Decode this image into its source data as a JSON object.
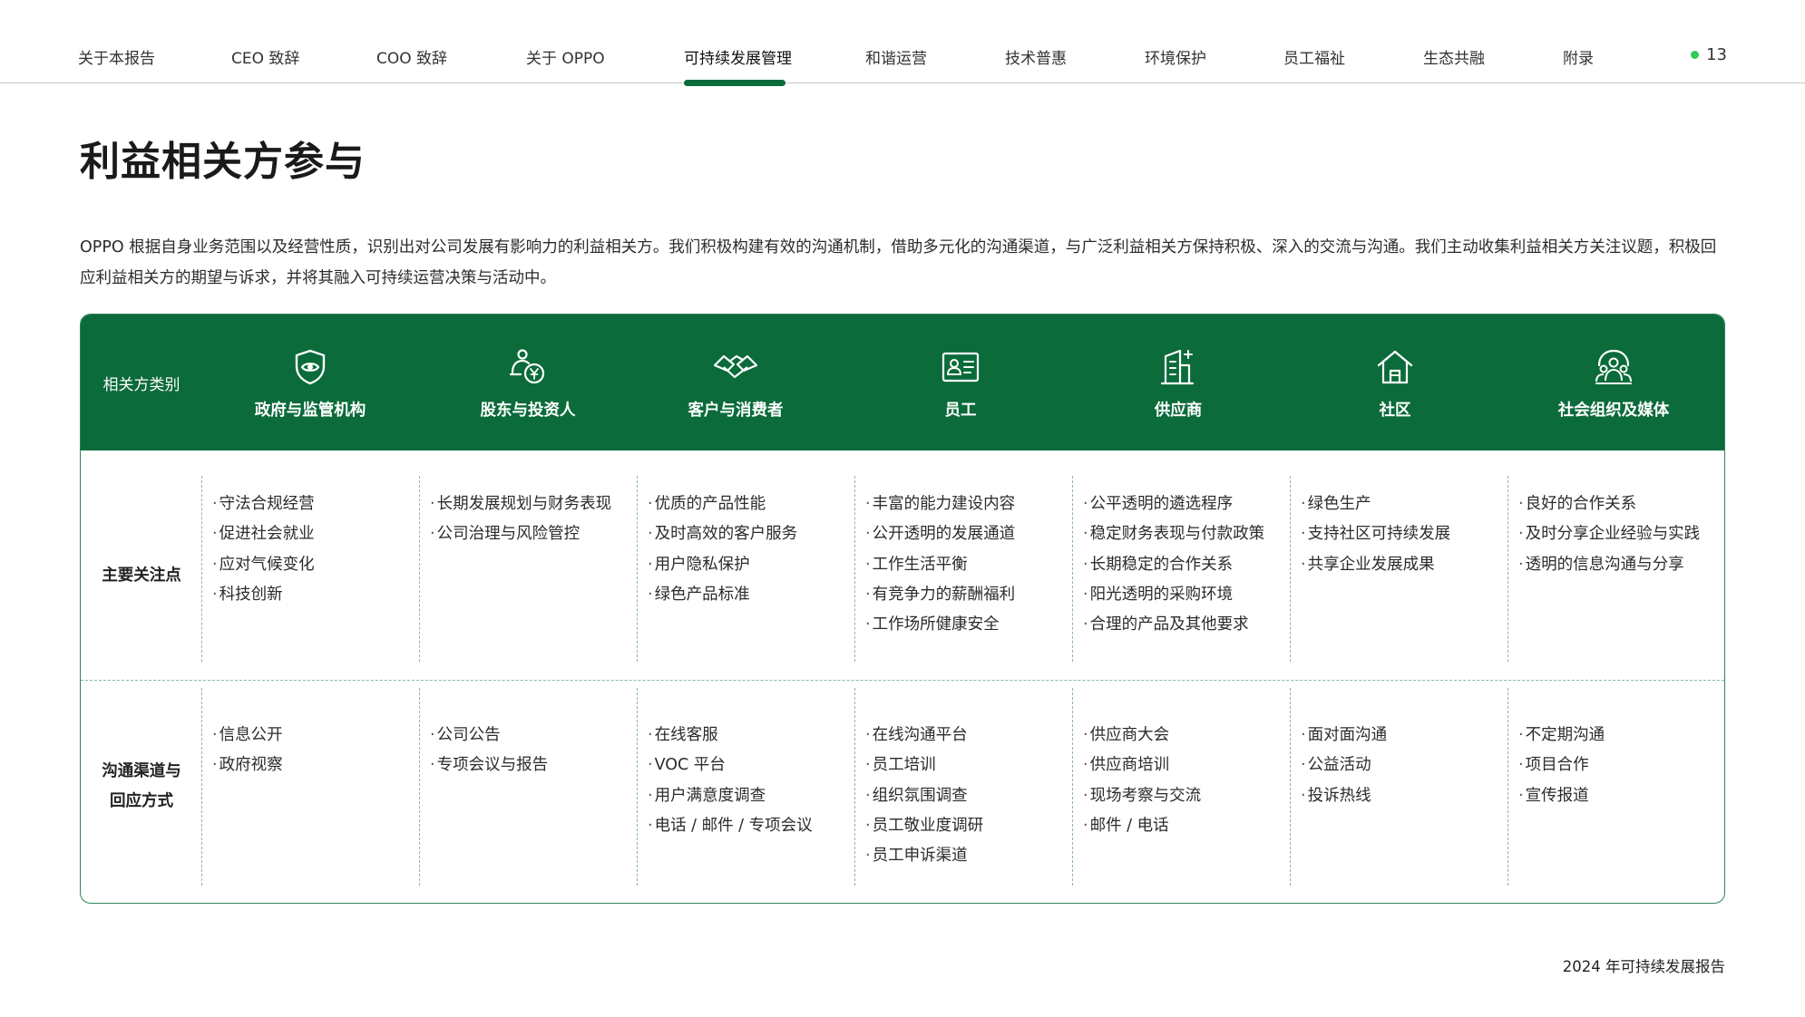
{
  "nav": {
    "items": [
      {
        "label": "关于本报告",
        "active": false
      },
      {
        "label": "CEO 致辞",
        "active": false
      },
      {
        "label": "COO 致辞",
        "active": false
      },
      {
        "label": "关于 OPPO",
        "active": false
      },
      {
        "label": "可持续发展管理",
        "active": true
      },
      {
        "label": "和谐运营",
        "active": false
      },
      {
        "label": "技术普惠",
        "active": false
      },
      {
        "label": "环境保护",
        "active": false
      },
      {
        "label": "员工福祉",
        "active": false
      },
      {
        "label": "生态共融",
        "active": false
      },
      {
        "label": "附录",
        "active": false
      }
    ],
    "page_number": "13",
    "accent_color": "#0b6b3a",
    "indicator_color": "#2ecc55"
  },
  "page": {
    "title": "利益相关方参与",
    "intro": "OPPO 根据自身业务范围以及经营性质，识别出对公司发展有影响力的利益相关方。我们积极构建有效的沟通机制，借助多元化的沟通渠道，与广泛利益相关方保持积极、深入的交流与沟通。我们主动收集利益相关方关注议题，积极回应利益相关方的期望与诉求，并将其融入可持续运营决策与活动中。",
    "footer": "2024 年可持续发展报告"
  },
  "table": {
    "header_label": "相关方类别",
    "concerns_label": "主要关注点",
    "channels_label_line1": "沟通渠道与",
    "channels_label_line2": "回应方式",
    "header_color": "#0b6b3a",
    "stakeholders": [
      {
        "name": "政府与监管机构",
        "icon": "shield-eye-icon",
        "concerns": [
          "守法合规经营",
          "促进社会就业",
          "应对气候变化",
          "科技创新"
        ],
        "channels": [
          "信息公开",
          "政府视察"
        ]
      },
      {
        "name": "股东与投资人",
        "icon": "investor-coin-icon",
        "concerns": [
          "长期发展规划与财务表现",
          "公司治理与风险管控"
        ],
        "channels": [
          "公司公告",
          "专项会议与报告"
        ]
      },
      {
        "name": "客户与消费者",
        "icon": "handshake-icon",
        "concerns": [
          "优质的产品性能",
          "及时高效的客户服务",
          "用户隐私保护",
          "绿色产品标准"
        ],
        "channels": [
          "在线客服",
          "VOC 平台",
          "用户满意度调查",
          "电话 / 邮件 / 专项会议"
        ]
      },
      {
        "name": "员工",
        "icon": "id-card-icon",
        "concerns": [
          "丰富的能力建设内容",
          "公开透明的发展通道",
          "工作生活平衡",
          "有竞争力的薪酬福利",
          "工作场所健康安全"
        ],
        "channels": [
          "在线沟通平台",
          "员工培训",
          "组织氛围调查",
          "员工敬业度调研",
          "员工申诉渠道"
        ]
      },
      {
        "name": "供应商",
        "icon": "building-plus-icon",
        "concerns": [
          "公平透明的遴选程序",
          "稳定财务表现与付款政策",
          "长期稳定的合作关系",
          "阳光透明的采购环境",
          "合理的产品及其他要求"
        ],
        "channels": [
          "供应商大会",
          "供应商培训",
          "现场考察与交流",
          "邮件 / 电话"
        ]
      },
      {
        "name": "社区",
        "icon": "house-icon",
        "concerns": [
          "绿色生产",
          "支持社区可持续发展",
          "共享企业发展成果"
        ],
        "channels": [
          "面对面沟通",
          "公益活动",
          "投诉热线"
        ]
      },
      {
        "name": "社会组织及媒体",
        "icon": "group-people-icon",
        "concerns": [
          "良好的合作关系",
          "及时分享企业经验与实践",
          "透明的信息沟通与分享"
        ],
        "channels": [
          "不定期沟通",
          "项目合作",
          "宣传报道"
        ]
      }
    ]
  }
}
